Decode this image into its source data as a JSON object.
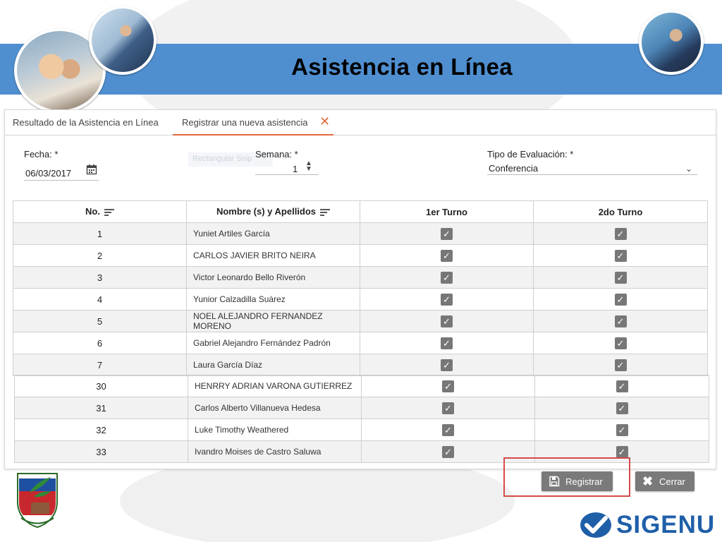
{
  "slide": {
    "title": "Asistencia en Línea",
    "brand": "SIGENU"
  },
  "tabs": [
    {
      "label": "Resultado de la Asistencia en Línea",
      "active": false
    },
    {
      "label": "Registrar una nueva asistencia",
      "active": true
    }
  ],
  "form": {
    "fecha_label": "Fecha: *",
    "fecha_value": "06/03/2017",
    "semana_label": "Semana: *",
    "semana_value": "1",
    "tipo_label": "Tipo de Evaluación: *",
    "tipo_value": "Conferencia",
    "ghost_text": "Rectangular Snip"
  },
  "table": {
    "headers": [
      "No.",
      "Nombre (s) y Apellidos",
      "1er Turno",
      "2do Turno"
    ],
    "rows": [
      {
        "no": "1",
        "name": "Yuniet Artiles García",
        "t1": true,
        "t2": true
      },
      {
        "no": "2",
        "name": "CARLOS JAVIER BRITO NEIRA",
        "t1": true,
        "t2": true
      },
      {
        "no": "3",
        "name": "Victor Leonardo Bello Riverón",
        "t1": true,
        "t2": true
      },
      {
        "no": "4",
        "name": "Yunior Calzadilla Suárez",
        "t1": true,
        "t2": true
      },
      {
        "no": "5",
        "name": "NOEL ALEJANDRO FERNANDEZ MORENO",
        "t1": true,
        "t2": true
      },
      {
        "no": "6",
        "name": "Gabriel Alejandro Fernández Padrón",
        "t1": true,
        "t2": true
      },
      {
        "no": "7",
        "name": "Laura García Díaz",
        "t1": true,
        "t2": true
      }
    ],
    "rows2": [
      {
        "no": "30",
        "name": "HENRRY ADRIAN VARONA GUTIERREZ",
        "t1": true,
        "t2": true
      },
      {
        "no": "31",
        "name": "Carlos Alberto Villanueva Hedesa",
        "t1": true,
        "t2": true
      },
      {
        "no": "32",
        "name": "Luke Timothy Weathered",
        "t1": true,
        "t2": true
      },
      {
        "no": "33",
        "name": "Ivandro Moises de Castro Saluwa",
        "t1": true,
        "t2": true
      }
    ]
  },
  "buttons": {
    "registrar": "Registrar",
    "cerrar": "Cerrar"
  },
  "colors": {
    "title_band": "#4f8fd0",
    "tab_accent": "#e46a3c",
    "highlight": "#d64b4b",
    "brand": "#1f5fa8",
    "button": "#7a7a7a"
  }
}
